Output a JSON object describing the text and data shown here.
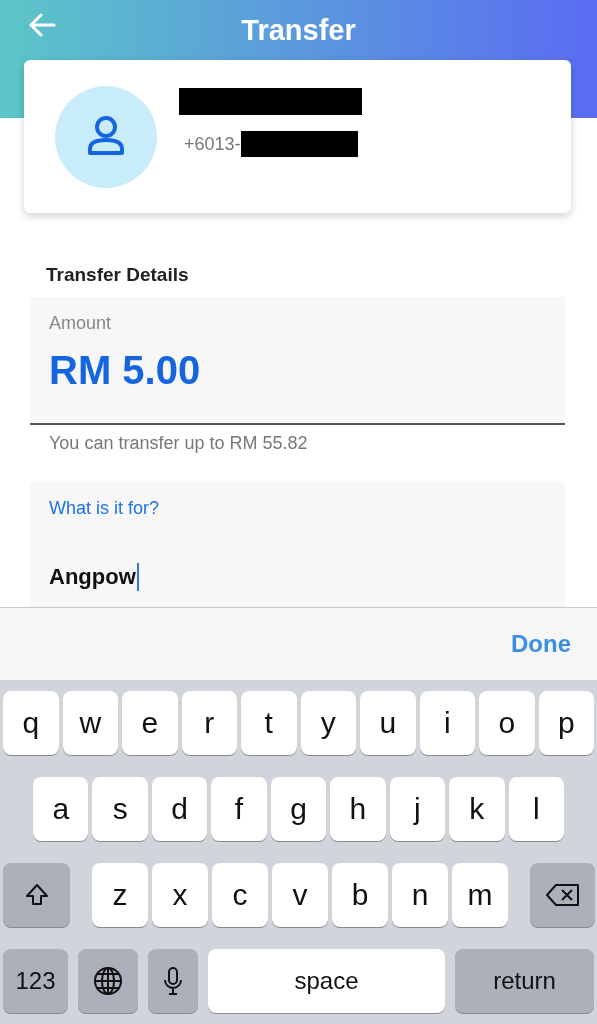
{
  "header": {
    "title": "Transfer"
  },
  "recipient": {
    "phone": "+6013-"
  },
  "details": {
    "heading": "Transfer Details",
    "amount": {
      "label": "Amount",
      "value": "RM 5.00",
      "hint": "You can transfer up to RM 55.82",
      "focused": false
    },
    "purpose": {
      "label": "What is it for?",
      "value": "Angpow",
      "focused": true
    }
  },
  "accessory": {
    "done": "Done"
  },
  "keyboard": {
    "rows": [
      {
        "keys": [
          {
            "kind": "letter",
            "label": "q"
          },
          {
            "kind": "letter",
            "label": "w"
          },
          {
            "kind": "letter",
            "label": "e"
          },
          {
            "kind": "letter",
            "label": "r"
          },
          {
            "kind": "letter",
            "label": "t"
          },
          {
            "kind": "letter",
            "label": "y"
          },
          {
            "kind": "letter",
            "label": "u"
          },
          {
            "kind": "letter",
            "label": "i"
          },
          {
            "kind": "letter",
            "label": "o"
          },
          {
            "kind": "letter",
            "label": "p"
          }
        ]
      },
      {
        "keys": [
          {
            "kind": "letter",
            "label": "a"
          },
          {
            "kind": "letter",
            "label": "s"
          },
          {
            "kind": "letter",
            "label": "d"
          },
          {
            "kind": "letter",
            "label": "f"
          },
          {
            "kind": "letter",
            "label": "g"
          },
          {
            "kind": "letter",
            "label": "h"
          },
          {
            "kind": "letter",
            "label": "j"
          },
          {
            "kind": "letter",
            "label": "k"
          },
          {
            "kind": "letter",
            "label": "l"
          }
        ]
      },
      {
        "keys": [
          {
            "kind": "shift"
          },
          {
            "kind": "letter",
            "label": "z"
          },
          {
            "kind": "letter",
            "label": "x"
          },
          {
            "kind": "letter",
            "label": "c"
          },
          {
            "kind": "letter",
            "label": "v"
          },
          {
            "kind": "letter",
            "label": "b"
          },
          {
            "kind": "letter",
            "label": "n"
          },
          {
            "kind": "letter",
            "label": "m"
          },
          {
            "kind": "delete"
          }
        ]
      },
      {
        "keys": [
          {
            "kind": "mode",
            "label": "123"
          },
          {
            "kind": "globe"
          },
          {
            "kind": "mic"
          },
          {
            "kind": "space",
            "label": "space"
          },
          {
            "kind": "return",
            "label": "return"
          }
        ]
      }
    ]
  }
}
